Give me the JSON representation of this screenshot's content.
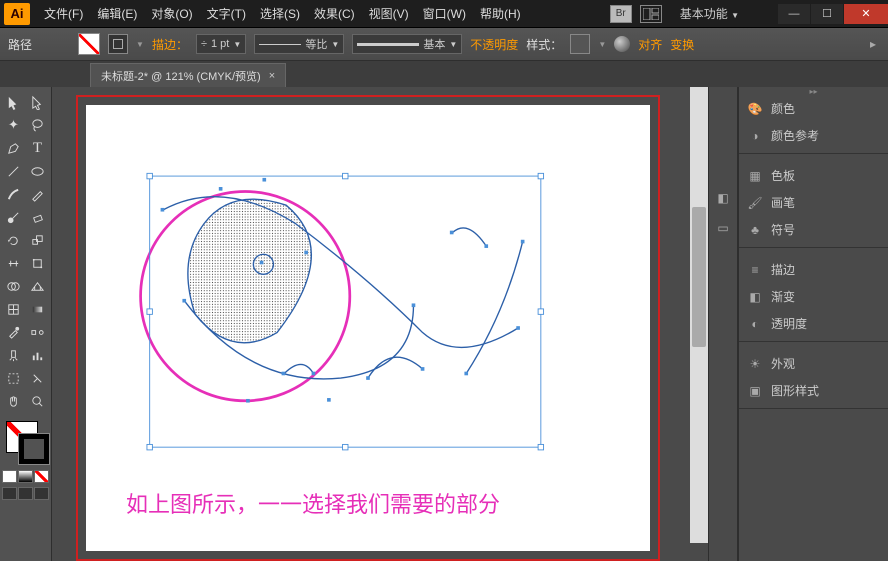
{
  "title_logo": "Ai",
  "menu": [
    "文件(F)",
    "编辑(E)",
    "对象(O)",
    "文字(T)",
    "选择(S)",
    "效果(C)",
    "视图(V)",
    "窗口(W)",
    "帮助(H)"
  ],
  "bridge": "Br",
  "workspace_label": "基本功能",
  "win": {
    "min": "—",
    "max": "☐",
    "close": "✕"
  },
  "control": {
    "mode": "路径",
    "stroke_label": "描边：",
    "stroke_pt": "1 pt",
    "uniform": "等比",
    "basic": "基本",
    "opacity": "不透明度",
    "style": "样式：",
    "align": "对齐",
    "transform": "变换"
  },
  "doc_tab": "未标题-2* @ 121% (CMYK/预览)",
  "caption": "如上图所示，一一选择我们需要的部分",
  "panels": {
    "color": "颜色",
    "color_guide": "颜色参考",
    "swatches": "色板",
    "brushes": "画笔",
    "symbols": "符号",
    "stroke": "描边",
    "gradient": "渐变",
    "transparency": "透明度",
    "appearance": "外观",
    "graphic_styles": "图形样式"
  }
}
